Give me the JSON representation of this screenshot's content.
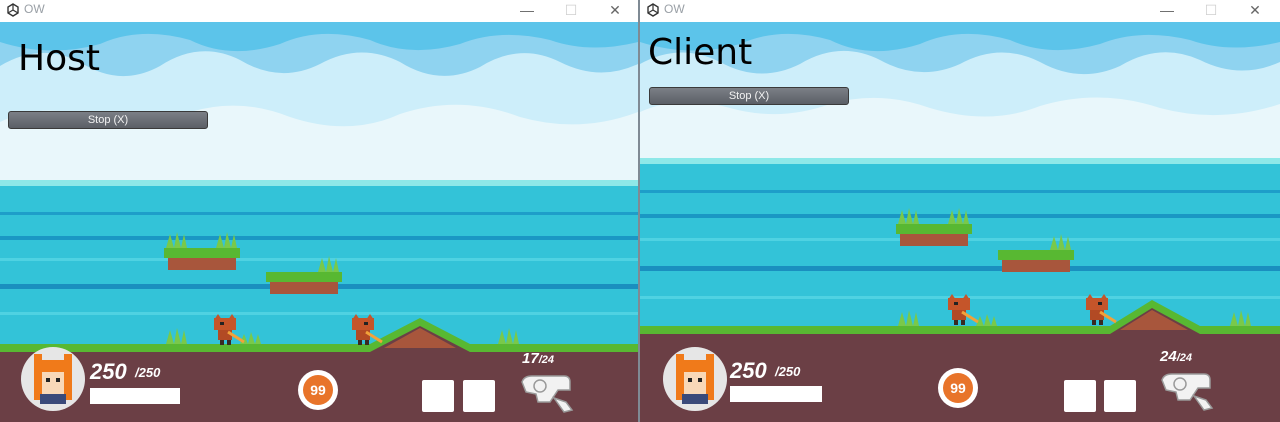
{
  "host": {
    "window_title": "OW",
    "label": "Host",
    "stop_button": "Stop (X)",
    "hp_current": "250",
    "hp_max": "/250",
    "ult_charge": "99",
    "ammo_current": "17",
    "ammo_max": "/24"
  },
  "client": {
    "window_title": "OW",
    "label": "Client",
    "stop_button": "Stop (X)",
    "hp_current": "250",
    "hp_max": "/250",
    "ult_charge": "99",
    "ammo_current": "24",
    "ammo_max": "/24"
  },
  "titlebar": {
    "minimize": "—",
    "maximize": "☐",
    "close": "✕"
  },
  "colors": {
    "sky": "#cdeefa",
    "cloud": "#8fd3f0",
    "sea": "#33c3d8",
    "ground": "#6b3f45",
    "grass": "#58b832",
    "ult": "#e8742a"
  },
  "icons": {
    "window": "unity-logo-icon",
    "player": "fox-icon",
    "hero": "hero-portrait-icon",
    "weapon": "pistol-icon"
  }
}
